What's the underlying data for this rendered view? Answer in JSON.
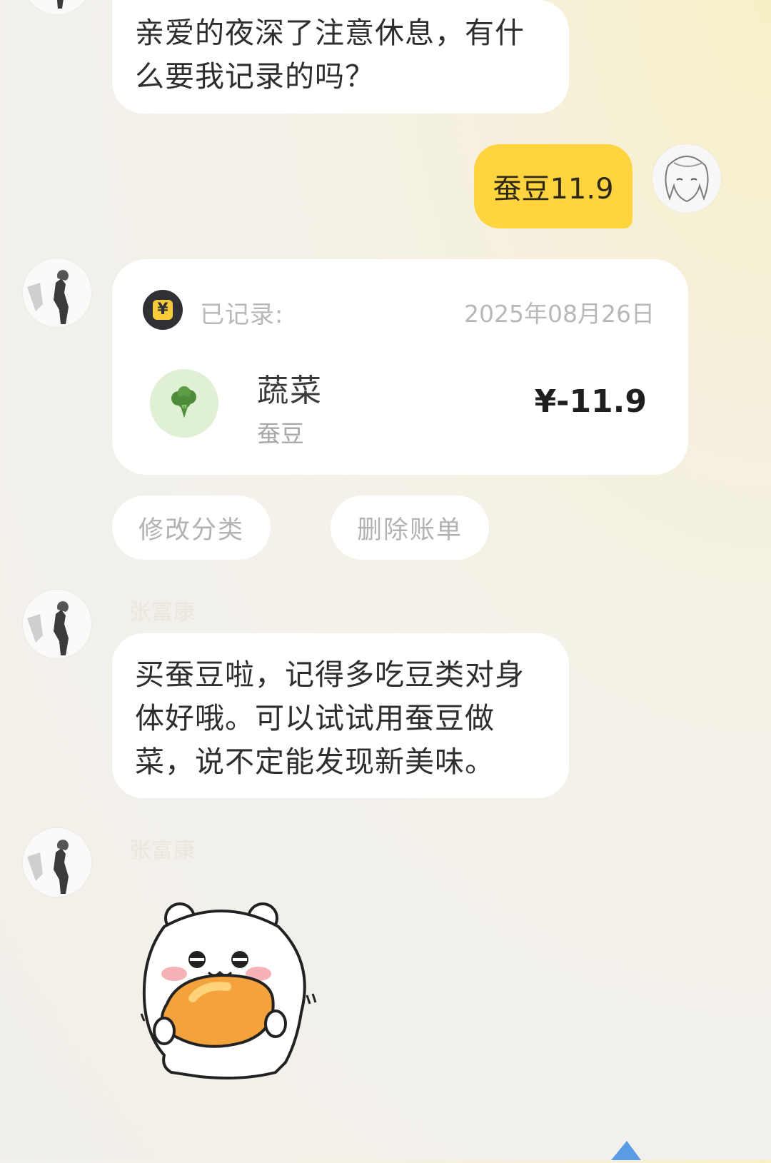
{
  "messages": {
    "greeting": "亲爱的夜深了注意休息，有什么要我记录的吗？",
    "user_input": "蚕豆11.9",
    "reply": "买蚕豆啦，记得多吃豆类对身体好哦。可以试试用蚕豆做菜，说不定能发现新美味。"
  },
  "record_card": {
    "status_label": "已记录:",
    "date": "2025年08月26日",
    "head_icon": "yen-badge-icon",
    "category": "蔬菜",
    "category_icon": "broccoli-icon",
    "note": "蚕豆",
    "amount": "¥-11.9"
  },
  "actions": {
    "edit_category": "修改分类",
    "delete_bill": "删除账单"
  },
  "sender_name": "张富康",
  "sticker": "hamster-eating-cookie-sticker",
  "colors": {
    "user_bubble": "#ffd43f",
    "card_bg": "#ffffff",
    "category_icon_bg": "#dff0d4"
  }
}
